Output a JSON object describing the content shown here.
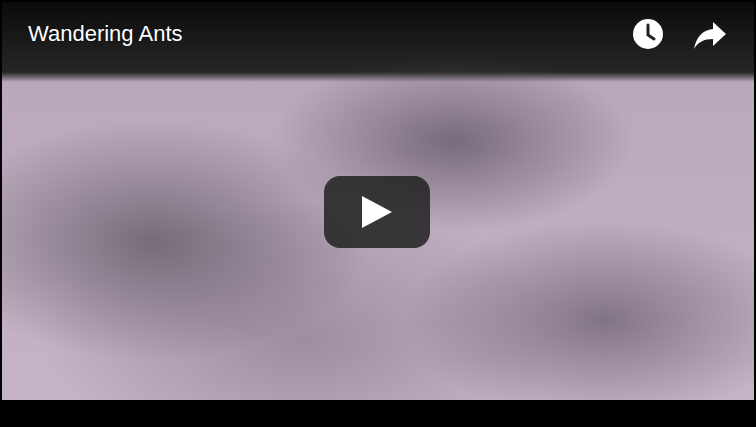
{
  "player": {
    "title": "Wandering Ants"
  }
}
